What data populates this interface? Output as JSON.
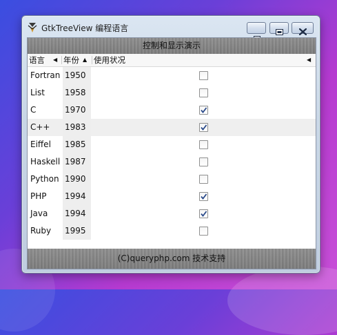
{
  "window": {
    "title": "GtkTreeView 编程语言"
  },
  "header_banner": "控制和显示演示",
  "columns": [
    {
      "label": "语言"
    },
    {
      "label": "年份"
    },
    {
      "label": "使用状况"
    }
  ],
  "rows": [
    {
      "language": "Fortran",
      "year": "1950",
      "checked": false
    },
    {
      "language": "List",
      "year": "1958",
      "checked": false
    },
    {
      "language": "C",
      "year": "1970",
      "checked": true
    },
    {
      "language": "C++",
      "year": "1983",
      "checked": true,
      "selected": true
    },
    {
      "language": "Eiffel",
      "year": "1985",
      "checked": false
    },
    {
      "language": "Haskell",
      "year": "1987",
      "checked": false
    },
    {
      "language": "Python",
      "year": "1990",
      "checked": false
    },
    {
      "language": "PHP",
      "year": "1994",
      "checked": true
    },
    {
      "language": "Java",
      "year": "1994",
      "checked": true
    },
    {
      "language": "Ruby",
      "year": "1995",
      "checked": false
    }
  ],
  "footer_banner": "(C)queryphp.com 技术支持",
  "icons": {
    "app": "gtk-app-icon",
    "minimize": "minimize-icon",
    "maximize": "maximize-icon",
    "close": "close-icon",
    "sort_lang": "sort-left-arrow-icon",
    "sort_year": "sort-up-arrow-icon",
    "sort_usage": "sort-left-arrow-icon"
  },
  "colors": {
    "checkmark": "#2a4a8a",
    "selected_row": "#efefef"
  }
}
